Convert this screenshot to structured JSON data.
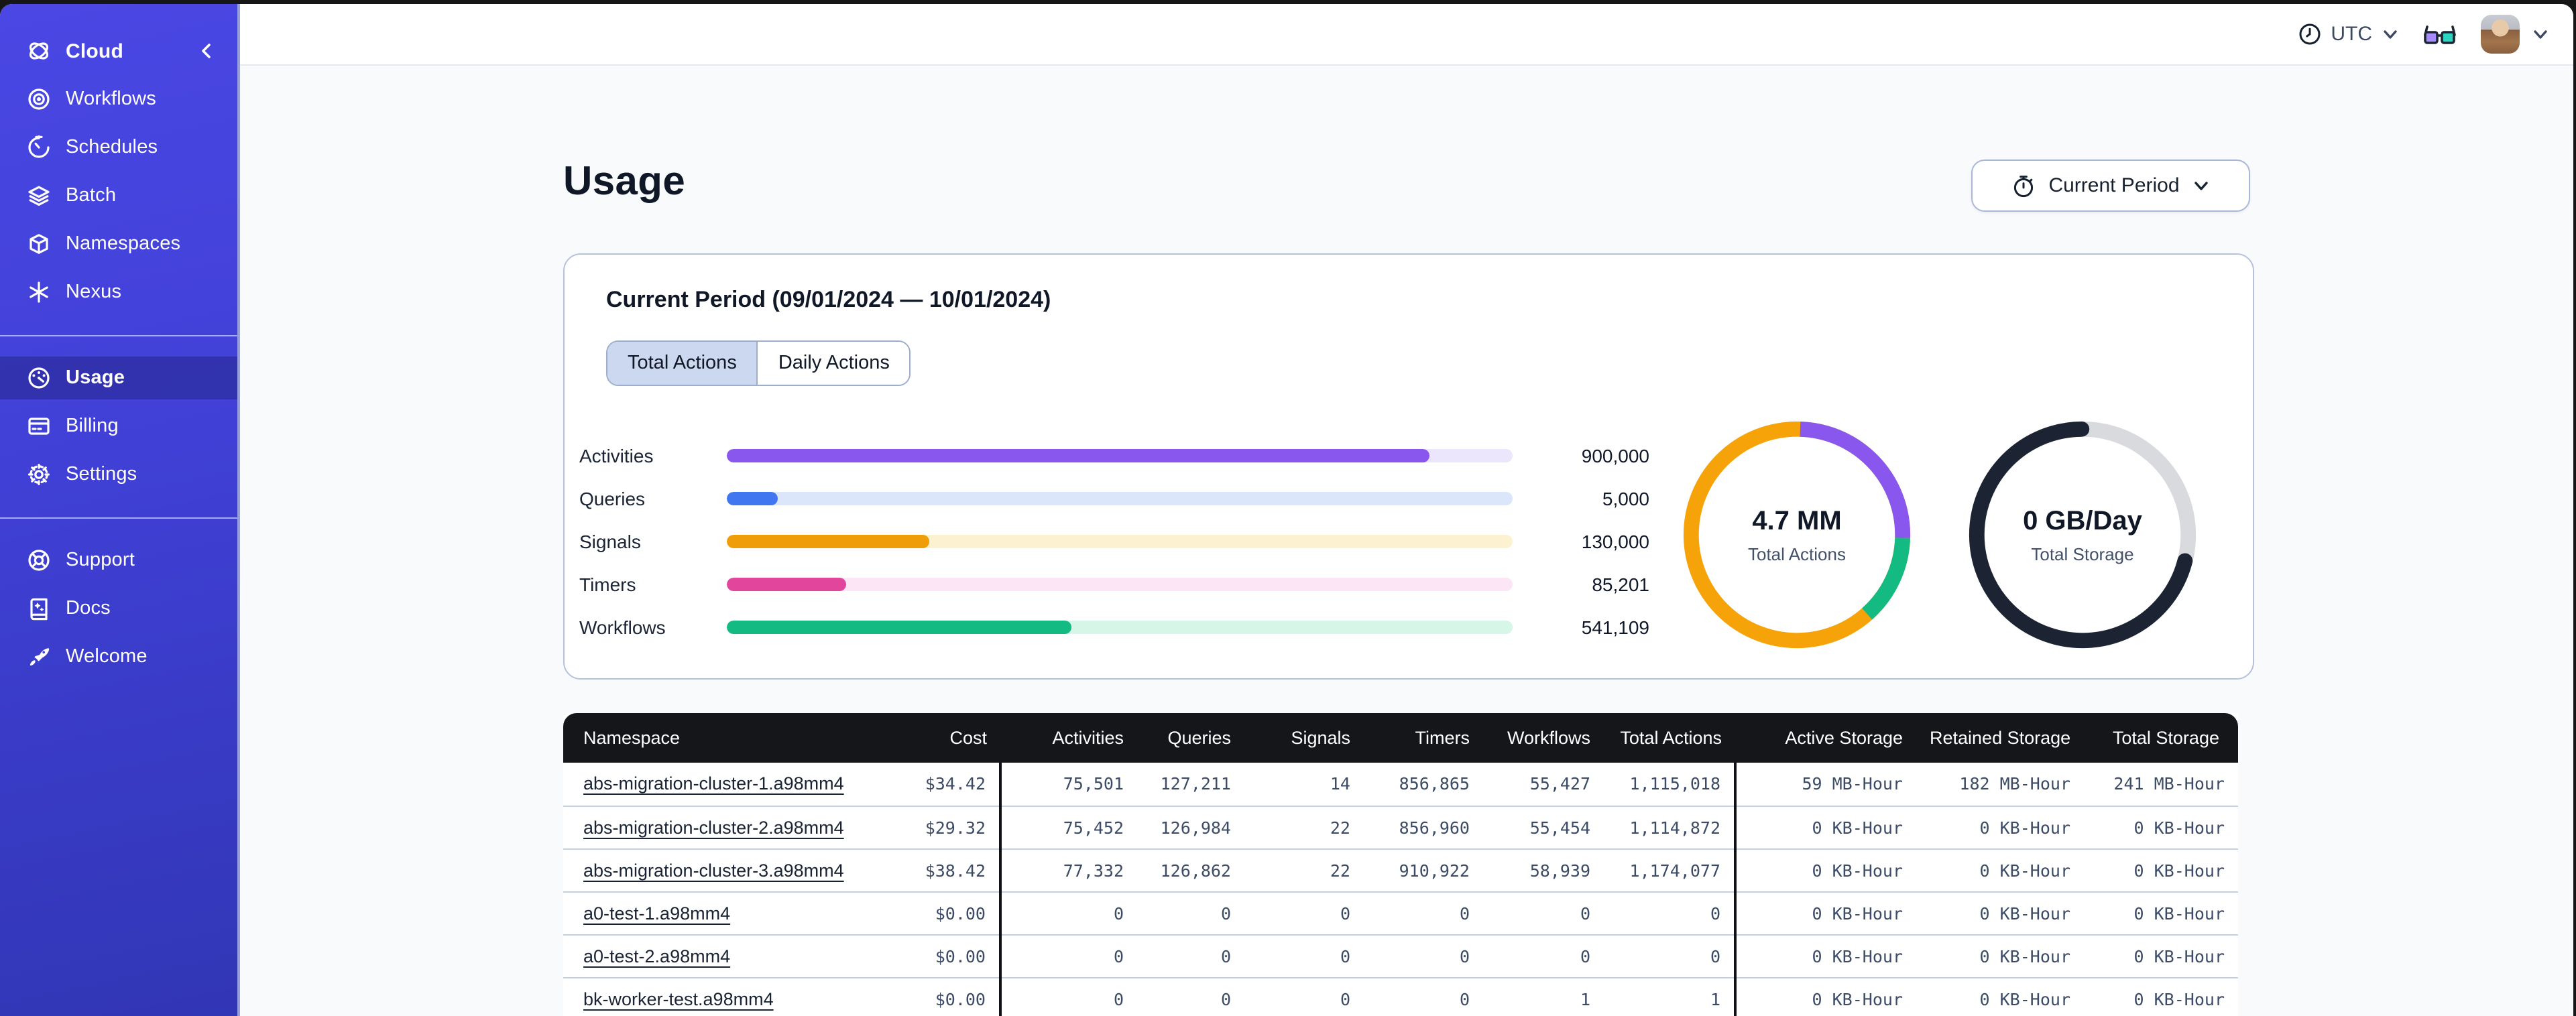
{
  "sidebar": {
    "brand": "Cloud",
    "main": [
      {
        "label": "Workflows"
      },
      {
        "label": "Schedules"
      },
      {
        "label": "Batch"
      },
      {
        "label": "Namespaces"
      },
      {
        "label": "Nexus"
      }
    ],
    "account": [
      {
        "label": "Usage",
        "active": true
      },
      {
        "label": "Billing",
        "active": false
      },
      {
        "label": "Settings",
        "active": false
      }
    ],
    "help": [
      {
        "label": "Support"
      },
      {
        "label": "Docs"
      },
      {
        "label": "Welcome"
      }
    ]
  },
  "topbar": {
    "timezone": "UTC"
  },
  "page": {
    "title": "Usage",
    "period_button": "Current Period"
  },
  "usage_card": {
    "title": "Current Period (09/01/2024 — 10/01/2024)",
    "tabs": [
      {
        "label": "Total Actions",
        "selected": true
      },
      {
        "label": "Daily Actions",
        "selected": false
      }
    ]
  },
  "chart_data": [
    {
      "type": "bar",
      "orientation": "horizontal",
      "categories": [
        "Activities",
        "Queries",
        "Signals",
        "Timers",
        "Workflows"
      ],
      "values": [
        900000,
        5000,
        130000,
        85201,
        541109
      ],
      "value_labels": [
        "900,000",
        "5,000",
        "130,000",
        "85,201",
        "541,109"
      ],
      "fill_pct": [
        89.5,
        6.5,
        25.8,
        15.2,
        43.8
      ],
      "colors": [
        "#8a57ee",
        "#4077f0",
        "#f09d0a",
        "#e1459c",
        "#13ba82"
      ],
      "track_colors": [
        "#ebe6fb",
        "#dbe6fa",
        "#fcf1d0",
        "#fce5f5",
        "#d6f6e8"
      ]
    },
    {
      "type": "donut",
      "id": "donut-actions",
      "center_value": "4.7 MM",
      "center_label": "Total Actions",
      "segments": [
        {
          "name": "activities",
          "color": "#8a57ee",
          "start_pct": 0.5,
          "pct": 25
        },
        {
          "name": "workflows",
          "color": "#13ba82",
          "start_pct": 25.5,
          "pct": 13
        },
        {
          "name": "other",
          "color": "#f5a309",
          "start_pct": 38.5,
          "pct": 62
        }
      ],
      "base_color": "#f5a309"
    },
    {
      "type": "donut",
      "id": "donut-storage",
      "center_value": "0 GB/Day",
      "center_label": "Total Storage",
      "segments": [
        {
          "name": "used",
          "color": "#1c2433",
          "start_pct": 29,
          "pct": 71,
          "round_cap": true
        }
      ],
      "base_color": "#d9dade"
    }
  ],
  "table": {
    "columns": [
      "Namespace",
      "Cost",
      "Activities",
      "Queries",
      "Signals",
      "Timers",
      "Workflows",
      "Total Actions",
      "Active Storage",
      "Retained Storage",
      "Total Storage"
    ],
    "rows": [
      [
        "abs-migration-cluster-1.a98mm4",
        "$34.42",
        "75,501",
        "127,211",
        "14",
        "856,865",
        "55,427",
        "1,115,018",
        "59 MB-Hour",
        "182 MB-Hour",
        "241 MB-Hour"
      ],
      [
        "abs-migration-cluster-2.a98mm4",
        "$29.32",
        "75,452",
        "126,984",
        "22",
        "856,960",
        "55,454",
        "1,114,872",
        "0 KB-Hour",
        "0 KB-Hour",
        "0 KB-Hour"
      ],
      [
        "abs-migration-cluster-3.a98mm4",
        "$38.42",
        "77,332",
        "126,862",
        "22",
        "910,922",
        "58,939",
        "1,174,077",
        "0 KB-Hour",
        "0 KB-Hour",
        "0 KB-Hour"
      ],
      [
        "a0-test-1.a98mm4",
        "$0.00",
        "0",
        "0",
        "0",
        "0",
        "0",
        "0",
        "0 KB-Hour",
        "0 KB-Hour",
        "0 KB-Hour"
      ],
      [
        "a0-test-2.a98mm4",
        "$0.00",
        "0",
        "0",
        "0",
        "0",
        "0",
        "0",
        "0 KB-Hour",
        "0 KB-Hour",
        "0 KB-Hour"
      ],
      [
        "bk-worker-test.a98mm4",
        "$0.00",
        "0",
        "0",
        "0",
        "0",
        "1",
        "1",
        "0 KB-Hour",
        "0 KB-Hour",
        "0 KB-Hour"
      ]
    ]
  }
}
